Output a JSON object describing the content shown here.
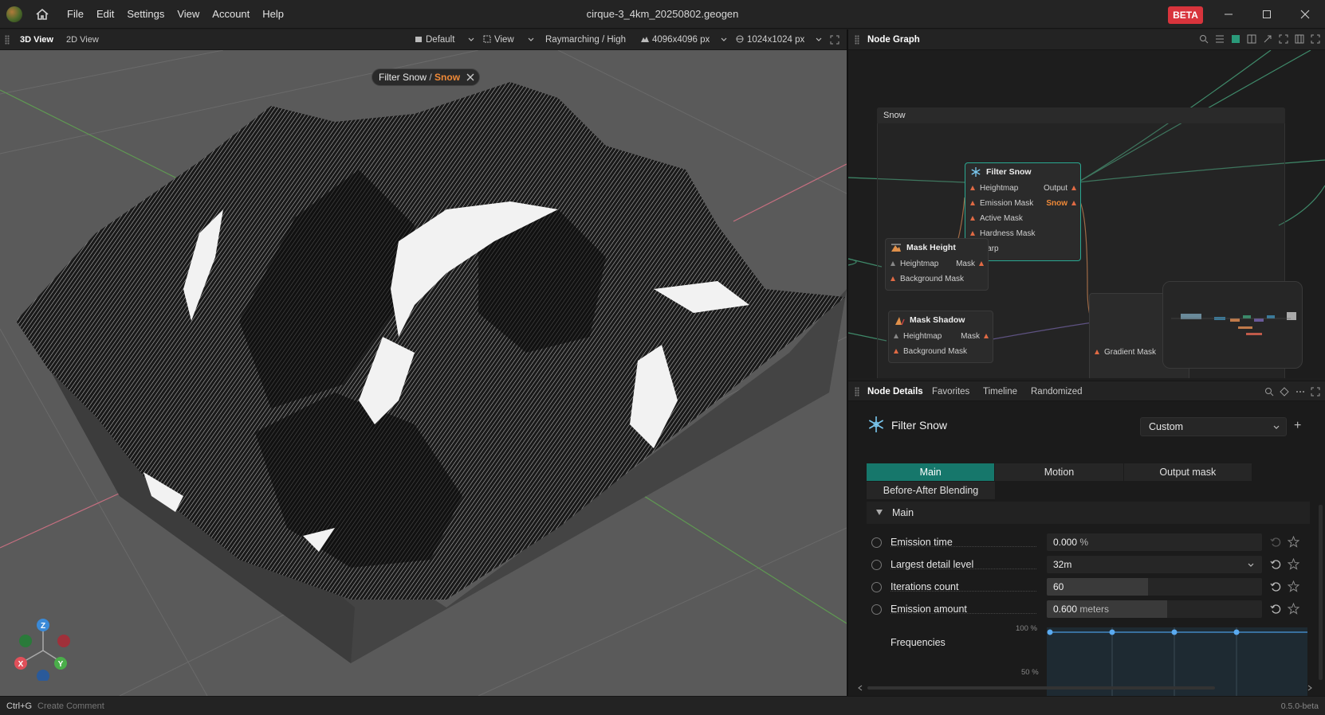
{
  "window": {
    "title": "cirque-3_4km_20250802.geogen",
    "badge": "BETA",
    "menu": [
      "File",
      "Edit",
      "Settings",
      "View",
      "Account",
      "Help"
    ]
  },
  "view_toolbar": {
    "tabs": [
      "3D View",
      "2D View"
    ],
    "camera": "Default",
    "view": "View",
    "render_mode": "Raymarching / High",
    "resolution": "4096x4096 px",
    "preview_resolution": "1024x1024 px"
  },
  "viewport": {
    "breadcrumb": {
      "node": "Filter Snow",
      "separator": " / ",
      "output": "Snow"
    },
    "gizmo": {
      "z": "Z",
      "y": "Y",
      "x": "X"
    }
  },
  "node_graph": {
    "header": "Node Graph",
    "group_title": "Snow",
    "nodes": {
      "filter_snow": {
        "title": "Filter Snow",
        "inputs": [
          "Heightmap",
          "Emission Mask",
          "Active Mask",
          "Hardness Mask",
          "Warp"
        ],
        "outputs": [
          "Output",
          "Snow"
        ]
      },
      "mask_height": {
        "title": "Mask Height",
        "inputs": [
          "Heightmap",
          "Background Mask"
        ],
        "outputs": [
          "Mask"
        ]
      },
      "mask_shadow": {
        "title": "Mask Shadow",
        "inputs": [
          "Heightmap",
          "Background Mask"
        ],
        "outputs": [
          "Mask"
        ]
      },
      "partial": {
        "port": "Gradient Mask"
      }
    }
  },
  "node_details": {
    "tabs": [
      "Node Details",
      "Favorites",
      "Timeline",
      "Randomized"
    ],
    "title": "Filter Snow",
    "preset": "Custom",
    "param_tabs": [
      "Main",
      "Motion",
      "Output mask"
    ],
    "param_tab_extra": "Before-After Blending",
    "section": "Main",
    "params": [
      {
        "name": "Emission time",
        "value": "0.000",
        "unit": " %",
        "fill": 0.0
      },
      {
        "name": "Largest detail level",
        "value": "32m",
        "unit": "",
        "fill": 0.0
      },
      {
        "name": "Iterations count",
        "value": "60",
        "unit": "",
        "fill": 0.47
      },
      {
        "name": "Emission amount",
        "value": "0.600",
        "unit": " meters",
        "fill": 0.56
      }
    ],
    "frequencies": {
      "label": "Frequencies",
      "tick_top": "100 %",
      "tick_mid": "50 %",
      "points": [
        1,
        1,
        1,
        1,
        1
      ]
    }
  },
  "statusbar": {
    "shortcut": "Ctrl+G",
    "hint": "Create Comment",
    "version": "0.5.0-beta"
  },
  "colors": {
    "accent": "#16776b",
    "selected_node": "#2aa891",
    "orange": "#f08a38",
    "beta": "#d8343c"
  }
}
